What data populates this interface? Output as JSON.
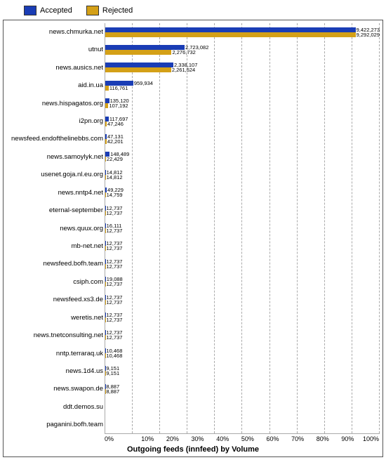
{
  "legend": {
    "accepted_label": "Accepted",
    "rejected_label": "Rejected",
    "accepted_color": "#1a3db5",
    "rejected_color": "#d4a017"
  },
  "chart_title": "Outgoing feeds (innfeed) by Volume",
  "x_axis_labels": [
    "0%",
    "10%",
    "20%",
    "30%",
    "40%",
    "50%",
    "60%",
    "70%",
    "80%",
    "90%",
    "100%"
  ],
  "rows": [
    {
      "name": "news.chmurka.net",
      "accepted": 9422273,
      "rejected": 9292029,
      "acc_pct": 99.5,
      "rej_pct": 98.0
    },
    {
      "name": "utnut",
      "accepted": 2723082,
      "rejected": 2276732,
      "acc_pct": 28.7,
      "rej_pct": 24.0
    },
    {
      "name": "news.ausics.net",
      "accepted": 2338107,
      "rejected": 2261524,
      "acc_pct": 24.7,
      "rej_pct": 23.9
    },
    {
      "name": "aid.in.ua",
      "accepted": 959934,
      "rejected": 116761,
      "acc_pct": 10.1,
      "rej_pct": 1.23
    },
    {
      "name": "news.hispagatos.org",
      "accepted": 135120,
      "rejected": 107192,
      "acc_pct": 1.43,
      "rej_pct": 1.13
    },
    {
      "name": "i2pn.org",
      "accepted": 117697,
      "rejected": 47246,
      "acc_pct": 1.24,
      "rej_pct": 0.5
    },
    {
      "name": "newsfeed.endofthelinebbs.com",
      "accepted": 47131,
      "rejected": 42201,
      "acc_pct": 0.5,
      "rej_pct": 0.45
    },
    {
      "name": "news.samoylyk.net",
      "accepted": 148489,
      "rejected": 22429,
      "acc_pct": 1.57,
      "rej_pct": 0.24
    },
    {
      "name": "usenet.goja.nl.eu.org",
      "accepted": 14812,
      "rejected": 14812,
      "acc_pct": 0.156,
      "rej_pct": 0.156
    },
    {
      "name": "news.nntp4.net",
      "accepted": 49229,
      "rejected": 14759,
      "acc_pct": 0.52,
      "rej_pct": 0.156
    },
    {
      "name": "eternal-september",
      "accepted": 12737,
      "rejected": 12737,
      "acc_pct": 0.134,
      "rej_pct": 0.134
    },
    {
      "name": "news.quux.org",
      "accepted": 16111,
      "rejected": 12737,
      "acc_pct": 0.17,
      "rej_pct": 0.134
    },
    {
      "name": "mb-net.net",
      "accepted": 12737,
      "rejected": 12737,
      "acc_pct": 0.134,
      "rej_pct": 0.134
    },
    {
      "name": "newsfeed.bofh.team",
      "accepted": 12737,
      "rejected": 12737,
      "acc_pct": 0.134,
      "rej_pct": 0.134
    },
    {
      "name": "csiph.com",
      "accepted": 19088,
      "rejected": 12737,
      "acc_pct": 0.2,
      "rej_pct": 0.134
    },
    {
      "name": "newsfeed.xs3.de",
      "accepted": 12737,
      "rejected": 12737,
      "acc_pct": 0.134,
      "rej_pct": 0.134
    },
    {
      "name": "weretis.net",
      "accepted": 12737,
      "rejected": 12737,
      "acc_pct": 0.134,
      "rej_pct": 0.134
    },
    {
      "name": "news.tnetconsulting.net",
      "accepted": 12737,
      "rejected": 12737,
      "acc_pct": 0.134,
      "rej_pct": 0.134
    },
    {
      "name": "nntp.terraraq.uk",
      "accepted": 10468,
      "rejected": 10468,
      "acc_pct": 0.11,
      "rej_pct": 0.11
    },
    {
      "name": "news.1d4.us",
      "accepted": 9151,
      "rejected": 9151,
      "acc_pct": 0.097,
      "rej_pct": 0.097
    },
    {
      "name": "news.swapon.de",
      "accepted": 8887,
      "rejected": 8887,
      "acc_pct": 0.094,
      "rej_pct": 0.094
    },
    {
      "name": "ddt.demos.su",
      "accepted": 0,
      "rejected": 0,
      "acc_pct": 0,
      "rej_pct": 0
    },
    {
      "name": "paganini.bofh.team",
      "accepted": 0,
      "rejected": 0,
      "acc_pct": 0,
      "rej_pct": 0
    }
  ]
}
